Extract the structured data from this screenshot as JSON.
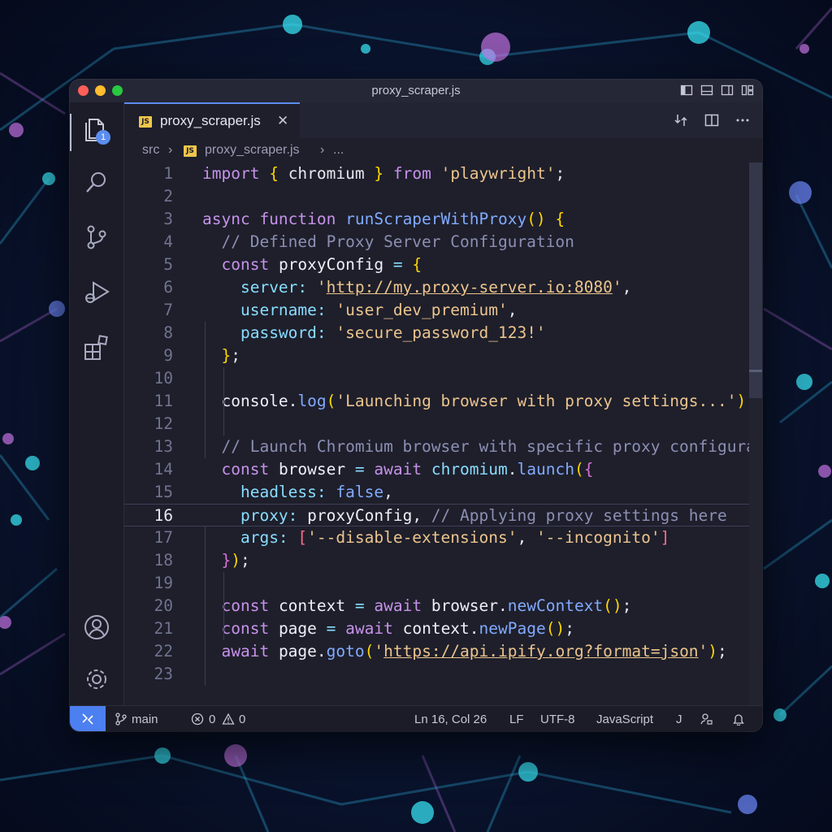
{
  "window": {
    "title": "proxy_scraper.js"
  },
  "activity_bar": {
    "explorer_badge": "1"
  },
  "tab": {
    "label": "proxy_scraper.js",
    "icon_text": "JS",
    "close": "✕"
  },
  "breadcrumb": {
    "folder": "src",
    "separator": "›",
    "file": "proxy_scraper.js",
    "more": "..."
  },
  "editor": {
    "current_line": 16,
    "lines": [
      {
        "n": "1",
        "tokens": [
          [
            "kw",
            "import"
          ],
          [
            "pl",
            " "
          ],
          [
            "br",
            "{"
          ],
          [
            "pl",
            " chromium "
          ],
          [
            "br",
            "}"
          ],
          [
            "pl",
            " "
          ],
          [
            "kw",
            "from"
          ],
          [
            "pl",
            " "
          ],
          [
            "str",
            "'playwright'"
          ],
          [
            "pl",
            ";"
          ]
        ]
      },
      {
        "n": "2",
        "tokens": []
      },
      {
        "n": "3",
        "tokens": [
          [
            "kw",
            "async function"
          ],
          [
            "pl",
            " "
          ],
          [
            "fn",
            "runScraperWithProxy"
          ],
          [
            "br",
            "()"
          ],
          [
            "pl",
            " "
          ],
          [
            "br",
            "{"
          ]
        ]
      },
      {
        "n": "4",
        "tokens": [
          [
            "pl",
            "  "
          ],
          [
            "cm",
            "// Defined Proxy Server Configuration"
          ]
        ]
      },
      {
        "n": "5",
        "tokens": [
          [
            "pl",
            "  "
          ],
          [
            "kw",
            "const"
          ],
          [
            "pl",
            " "
          ],
          [
            "var",
            "proxyConfig"
          ],
          [
            "pl",
            " "
          ],
          [
            "op",
            "="
          ],
          [
            "pl",
            " "
          ],
          [
            "br",
            "{"
          ]
        ]
      },
      {
        "n": "6",
        "tokens": [
          [
            "pl",
            "    "
          ],
          [
            "prop",
            "server:"
          ],
          [
            "pl",
            " "
          ],
          [
            "str",
            "'"
          ],
          [
            "url",
            "http://my.proxy-server.io:8080"
          ],
          [
            "str",
            "'"
          ],
          [
            "pl",
            ","
          ]
        ]
      },
      {
        "n": "7",
        "tokens": [
          [
            "pl",
            "    "
          ],
          [
            "prop",
            "username:"
          ],
          [
            "pl",
            " "
          ],
          [
            "str",
            "'user_dev_premium'"
          ],
          [
            "pl",
            ","
          ]
        ]
      },
      {
        "n": "8",
        "tokens": [
          [
            "pl",
            "    "
          ],
          [
            "prop",
            "password:"
          ],
          [
            "pl",
            " "
          ],
          [
            "str",
            "'secure_password_123!'"
          ]
        ]
      },
      {
        "n": "9",
        "tokens": [
          [
            "pl",
            "  "
          ],
          [
            "br",
            "}"
          ],
          [
            "pl",
            ";"
          ]
        ]
      },
      {
        "n": "10",
        "tokens": []
      },
      {
        "n": "11",
        "tokens": [
          [
            "pl",
            "  "
          ],
          [
            "var",
            "console"
          ],
          [
            "pl",
            "."
          ],
          [
            "fn",
            "log"
          ],
          [
            "br",
            "("
          ],
          [
            "str",
            "'Launching browser with proxy settings...'"
          ],
          [
            "br",
            ")"
          ],
          [
            "pl",
            ";"
          ]
        ]
      },
      {
        "n": "12",
        "tokens": []
      },
      {
        "n": "13",
        "tokens": [
          [
            "pl",
            "  "
          ],
          [
            "cm",
            "// Launch Chromium browser with specific proxy configuration"
          ]
        ]
      },
      {
        "n": "14",
        "tokens": [
          [
            "pl",
            "  "
          ],
          [
            "kw",
            "const"
          ],
          [
            "pl",
            " "
          ],
          [
            "var",
            "browser"
          ],
          [
            "pl",
            " "
          ],
          [
            "op",
            "="
          ],
          [
            "pl",
            " "
          ],
          [
            "kw",
            "await"
          ],
          [
            "pl",
            " "
          ],
          [
            "prop",
            "chromium"
          ],
          [
            "pl",
            "."
          ],
          [
            "fn",
            "launch"
          ],
          [
            "br",
            "("
          ],
          [
            "br2",
            "{"
          ]
        ]
      },
      {
        "n": "15",
        "tokens": [
          [
            "pl",
            "    "
          ],
          [
            "prop",
            "headless:"
          ],
          [
            "pl",
            " "
          ],
          [
            "bool",
            "false"
          ],
          [
            "pl",
            ","
          ]
        ]
      },
      {
        "n": "16",
        "tokens": [
          [
            "pl",
            "    "
          ],
          [
            "prop",
            "proxy:"
          ],
          [
            "pl",
            " "
          ],
          [
            "var",
            "proxyConfig"
          ],
          [
            "pl",
            ", "
          ],
          [
            "cm",
            "// Applying proxy settings here"
          ]
        ]
      },
      {
        "n": "17",
        "tokens": [
          [
            "pl",
            "    "
          ],
          [
            "prop",
            "args:"
          ],
          [
            "pl",
            " "
          ],
          [
            "red",
            "["
          ],
          [
            "str",
            "'--disable-extensions'"
          ],
          [
            "pl",
            ", "
          ],
          [
            "str",
            "'--incognito'"
          ],
          [
            "red",
            "]"
          ]
        ]
      },
      {
        "n": "18",
        "tokens": [
          [
            "pl",
            "  "
          ],
          [
            "br2",
            "}"
          ],
          [
            "br",
            ")"
          ],
          [
            "pl",
            ";"
          ]
        ]
      },
      {
        "n": "19",
        "tokens": []
      },
      {
        "n": "20",
        "tokens": [
          [
            "pl",
            "  "
          ],
          [
            "kw",
            "const"
          ],
          [
            "pl",
            " "
          ],
          [
            "var",
            "context"
          ],
          [
            "pl",
            " "
          ],
          [
            "op",
            "="
          ],
          [
            "pl",
            " "
          ],
          [
            "kw",
            "await"
          ],
          [
            "pl",
            " "
          ],
          [
            "var",
            "browser"
          ],
          [
            "pl",
            "."
          ],
          [
            "fn",
            "newContext"
          ],
          [
            "br",
            "()"
          ],
          [
            "pl",
            ";"
          ]
        ]
      },
      {
        "n": "21",
        "tokens": [
          [
            "pl",
            "  "
          ],
          [
            "kw",
            "const"
          ],
          [
            "pl",
            " "
          ],
          [
            "var",
            "page"
          ],
          [
            "pl",
            " "
          ],
          [
            "op",
            "="
          ],
          [
            "pl",
            " "
          ],
          [
            "kw",
            "await"
          ],
          [
            "pl",
            " "
          ],
          [
            "var",
            "context"
          ],
          [
            "pl",
            "."
          ],
          [
            "fn",
            "newPage"
          ],
          [
            "br",
            "()"
          ],
          [
            "pl",
            ";"
          ]
        ]
      },
      {
        "n": "22",
        "tokens": [
          [
            "pl",
            "  "
          ],
          [
            "kw",
            "await"
          ],
          [
            "pl",
            " "
          ],
          [
            "var",
            "page"
          ],
          [
            "pl",
            "."
          ],
          [
            "fn",
            "goto"
          ],
          [
            "br",
            "("
          ],
          [
            "str",
            "'"
          ],
          [
            "url",
            "https://api.ipify.org?format=json"
          ],
          [
            "str",
            "'"
          ],
          [
            "br",
            ")"
          ],
          [
            "pl",
            ";"
          ]
        ]
      },
      {
        "n": "23",
        "tokens": []
      }
    ]
  },
  "statusbar": {
    "branch": "main",
    "errors": "0",
    "warnings": "0",
    "position": "Ln 16, Col 26",
    "eol": "LF",
    "encoding": "UTF-8",
    "language": "JavaScript",
    "extra": "J"
  },
  "colors": {
    "accent": "#5b8def",
    "remote_indicator": "#4c7ff0",
    "editor_bg": "#1e1f2b",
    "keyword": "#c792ea",
    "string": "#ecc48d",
    "function": "#82aaff",
    "comment": "#8c8fb3"
  },
  "icons": {
    "titlebar": [
      "layout-sidebar-left-icon",
      "layout-panel-icon",
      "layout-sidebar-right-icon",
      "customize-layout-icon"
    ],
    "activity": [
      "files-icon",
      "search-icon",
      "source-control-icon",
      "run-debug-icon",
      "extensions-icon",
      "account-icon",
      "settings-gear-icon"
    ],
    "tab_actions": [
      "open-changes-icon",
      "split-editor-icon",
      "more-actions-icon"
    ],
    "statusbar": [
      "remote-icon",
      "git-branch-icon",
      "error-icon",
      "warning-icon",
      "feedback-icon",
      "bell-icon"
    ]
  }
}
